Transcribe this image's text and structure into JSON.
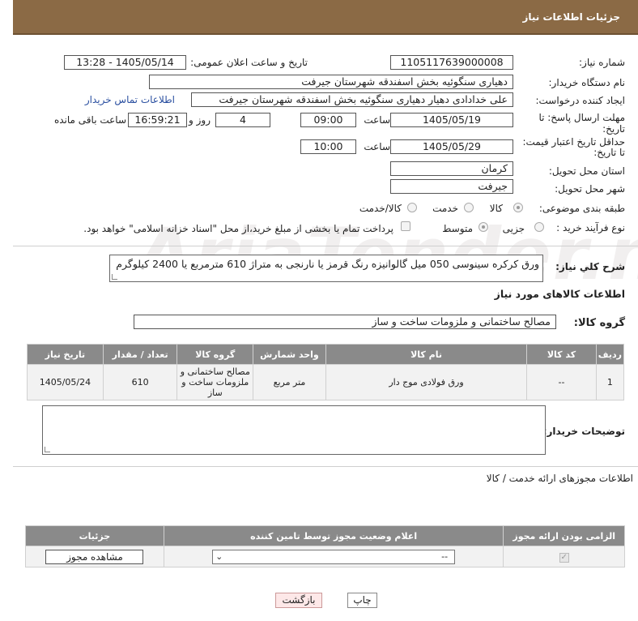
{
  "header": {
    "title": "جزئیات اطلاعات نیاز"
  },
  "form": {
    "need_number_label": "شماره نیاز:",
    "need_number": "1105117639000008",
    "announce_label": "تاریخ و ساعت اعلان عمومی:",
    "announce_value": "1405/05/14 - 13:28",
    "buyer_org_label": "نام دستگاه خریدار:",
    "buyer_org": "دهیاری سنگوئیه بخش اسفندقه شهرستان جیرفت",
    "creator_label": "ایجاد کننده درخواست:",
    "creator": "علی خدادادی دهیار دهیاری سنگوئیه بخش اسفندقه شهرستان جیرفت",
    "contact_link": "اطلاعات تماس خریدار",
    "deadline_label_1": "مهلت ارسال پاسخ: تا",
    "deadline_label_2": "تاریخ:",
    "deadline_date": "1405/05/19",
    "hour_label": "ساعت",
    "deadline_time": "09:00",
    "days_value": "4",
    "days_label": "روز و",
    "remaining_time": "16:59:21",
    "remaining_label": "ساعت باقی مانده",
    "validity_label_1": "حداقل تاریخ اعتبار قیمت:",
    "validity_label_2": "تا تاریخ:",
    "validity_date": "1405/05/29",
    "validity_hour_label": "ساعت",
    "validity_time": "10:00",
    "province_label": "استان محل تحویل:",
    "province": "کرمان",
    "city_label": "شهر محل تحویل:",
    "city": "جیرفت",
    "category_label": "طبقه بندی موضوعی:",
    "category_options": [
      "کالا",
      "خدمت",
      "کالا/خدمت"
    ],
    "category_selected": "کالا",
    "process_label": "نوع فرآیند خرید :",
    "process_options": [
      "جزیی",
      "متوسط"
    ],
    "process_selected": "متوسط",
    "payment_note": "پرداخت تمام یا بخشی از مبلغ خرید،از محل \"اسناد خزانه اسلامی\" خواهد بود."
  },
  "description": {
    "label": "شرح کلي نياز:",
    "text": "ورق کرکره سینوسی 050 میل گالوانیزه رنگ قرمز یا نارنجی به متراژ 610 مترمربع یا 2400 کیلوگرم"
  },
  "goods": {
    "section_title": "اطلاعات کالاهای مورد نیاز",
    "group_label": "گروه کالا:",
    "group_value": "مصالح ساختمانی و ملزومات ساخت و ساز",
    "columns": [
      "ردیف",
      "کد کالا",
      "نام کالا",
      "واحد شمارش",
      "گروه کالا",
      "تعداد / مقدار",
      "تاریخ نیاز"
    ],
    "rows": [
      {
        "index": "1",
        "code": "--",
        "name": "ورق فولادی موج دار",
        "unit": "متر مربع",
        "group": "مصالح ساختمانی و ملزومات ساخت و ساز",
        "qty": "610",
        "date": "1405/05/24"
      }
    ]
  },
  "buyer_notes": {
    "label": "توضیحات خریدار:",
    "text": ""
  },
  "permits": {
    "section_title": "اطلاعات مجوزهای ارائه خدمت / کالا",
    "columns": [
      "الزامی بودن ارائه مجوز",
      "اعلام وضعیت مجوز توسط تامین کننده",
      "جزئیات"
    ],
    "select_value": "--",
    "view_button": "مشاهده مجوز"
  },
  "buttons": {
    "print": "چاپ",
    "back": "بازگشت"
  },
  "watermark": "AriaTender.net"
}
